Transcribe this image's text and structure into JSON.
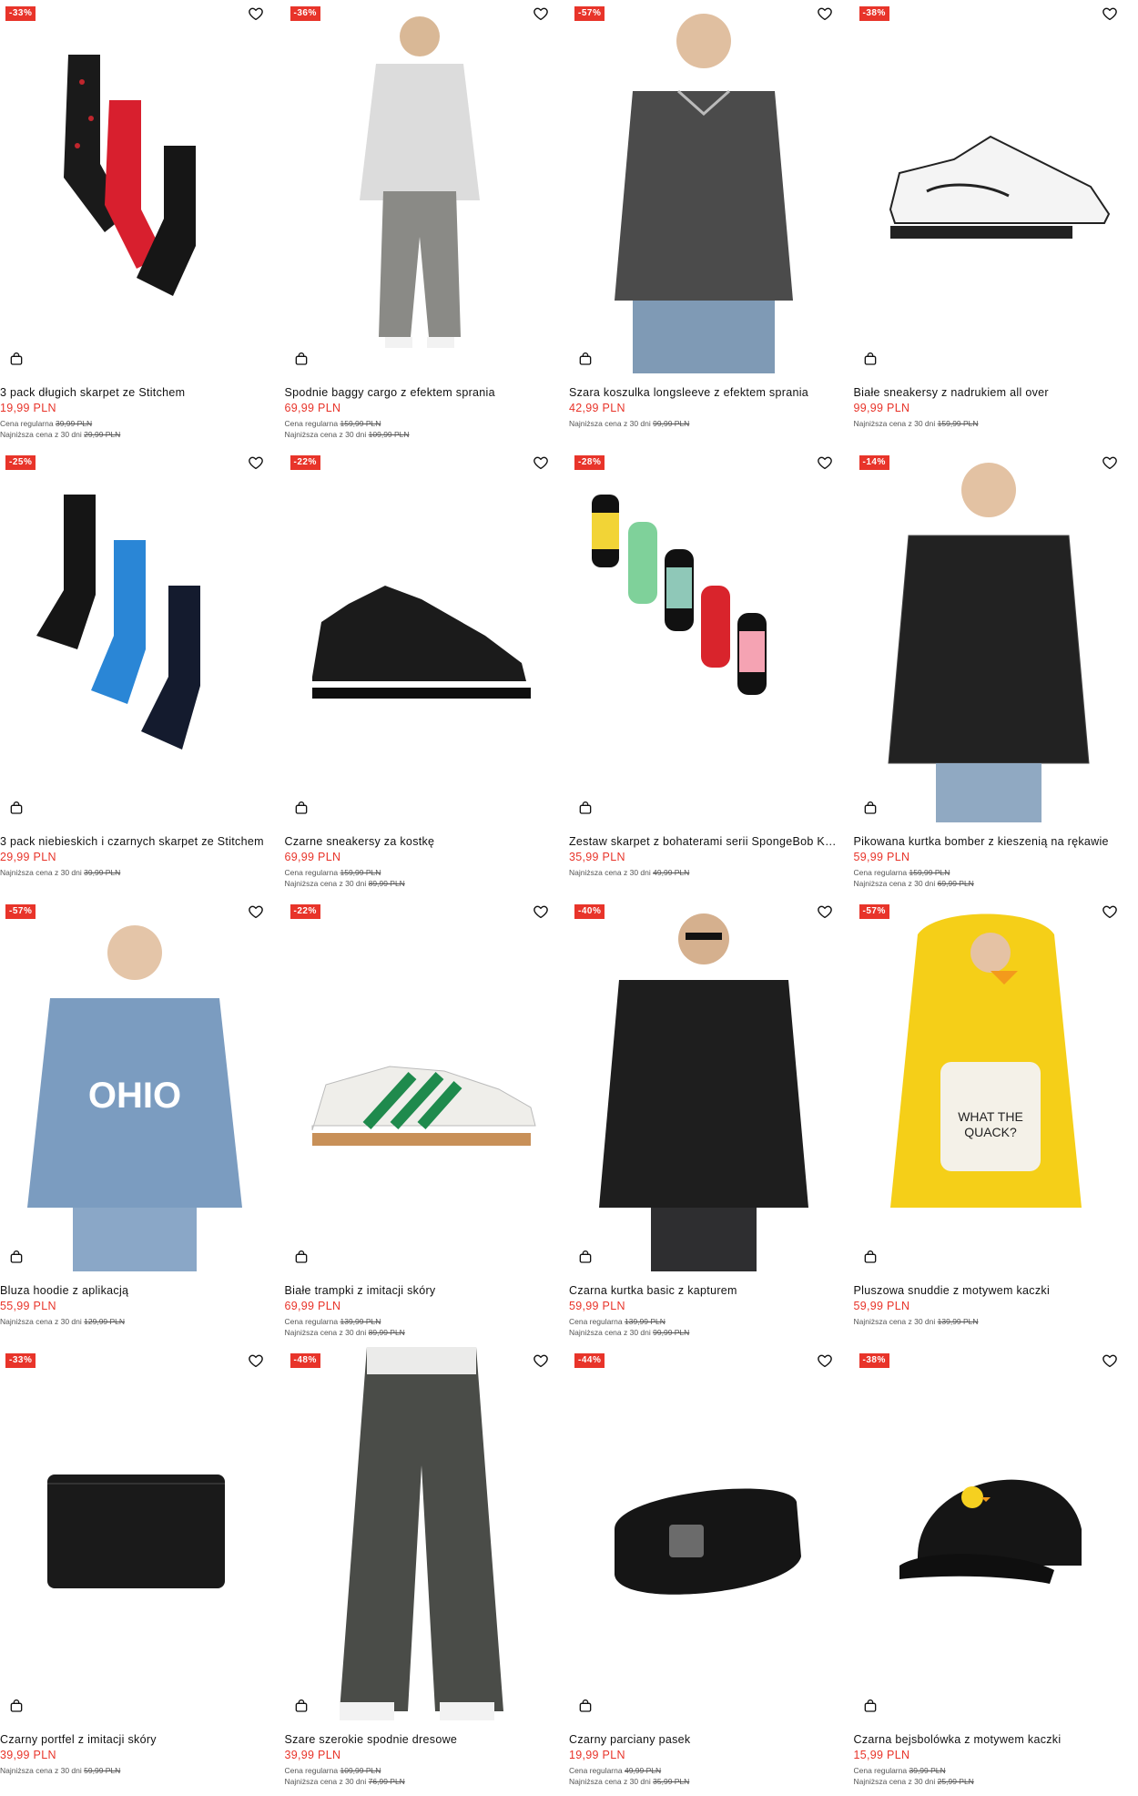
{
  "colors": {
    "accent": "#e8342a",
    "text": "#111111",
    "muted": "#555555"
  },
  "labels": {
    "regular": "Cena regularna",
    "lowest": "Najniższa cena z 30 dni"
  },
  "products": [
    {
      "badge": "-33%",
      "name": "3 pack długich skarpet ze Stitchem",
      "price": "19,99 PLN",
      "regular": "39,99 PLN",
      "lowest": "29,99 PLN",
      "art": "socks-red"
    },
    {
      "badge": "-36%",
      "name": "Spodnie baggy cargo z efektem sprania",
      "price": "69,99 PLN",
      "regular": "159,99 PLN",
      "lowest": "109,99 PLN",
      "art": "model-jacket"
    },
    {
      "badge": "-57%",
      "name": "Szara koszulka longsleeve z efektem sprania",
      "price": "42,99 PLN",
      "regular": null,
      "lowest": "99,99 PLN",
      "art": "model-longsleeve"
    },
    {
      "badge": "-38%",
      "name": "Białe sneakersy z nadrukiem all over",
      "price": "99,99 PLN",
      "regular": null,
      "lowest": "159,99 PLN",
      "art": "sneaker-white"
    },
    {
      "badge": "-25%",
      "name": "3 pack niebieskich i czarnych skarpet ze Stitchem",
      "price": "29,99 PLN",
      "regular": null,
      "lowest": "39,99 PLN",
      "art": "socks-blue"
    },
    {
      "badge": "-22%",
      "name": "Czarne sneakersy za kostkę",
      "price": "69,99 PLN",
      "regular": "159,99 PLN",
      "lowest": "89,99 PLN",
      "art": "sneaker-black"
    },
    {
      "badge": "-28%",
      "name": "Zestaw skarpet z bohaterami serii SpongeBob Kanciastoporty",
      "price": "35,99 PLN",
      "regular": null,
      "lowest": "49,99 PLN",
      "art": "socks-sponge"
    },
    {
      "badge": "-14%",
      "name": "Pikowana kurtka bomber z kieszenią na rękawie",
      "price": "59,99 PLN",
      "regular": "159,99 PLN",
      "lowest": "69,99 PLN",
      "art": "model-bomber"
    },
    {
      "badge": "-57%",
      "name": "Bluza hoodie z aplikacją",
      "price": "55,99 PLN",
      "regular": null,
      "lowest": "129,99 PLN",
      "art": "model-hoodie"
    },
    {
      "badge": "-22%",
      "name": "Białe trampki z imitacji skóry",
      "price": "69,99 PLN",
      "regular": "139,99 PLN",
      "lowest": "89,99 PLN",
      "art": "sneaker-green"
    },
    {
      "badge": "-40%",
      "name": "Czarna kurtka basic z kapturem",
      "price": "59,99 PLN",
      "regular": "139,99 PLN",
      "lowest": "99,99 PLN",
      "art": "model-blackjacket"
    },
    {
      "badge": "-57%",
      "name": "Pluszowa snuddie z motywem kaczki",
      "price": "59,99 PLN",
      "regular": null,
      "lowest": "139,99 PLN",
      "art": "model-duck"
    },
    {
      "badge": "-33%",
      "name": "Czarny portfel z imitacji skóry",
      "price": "39,99 PLN",
      "regular": null,
      "lowest": "59,99 PLN",
      "art": "wallet"
    },
    {
      "badge": "-48%",
      "name": "Szare szerokie spodnie dresowe",
      "price": "39,99 PLN",
      "regular": "109,99 PLN",
      "lowest": "76,99 PLN",
      "art": "pants"
    },
    {
      "badge": "-44%",
      "name": "Czarny parciany pasek",
      "price": "19,99 PLN",
      "regular": "49,99 PLN",
      "lowest": "35,99 PLN",
      "art": "belt"
    },
    {
      "badge": "-38%",
      "name": "Czarna bejsbolówka z motywem kaczki",
      "price": "15,99 PLN",
      "regular": "39,99 PLN",
      "lowest": "25,99 PLN",
      "art": "cap"
    }
  ]
}
